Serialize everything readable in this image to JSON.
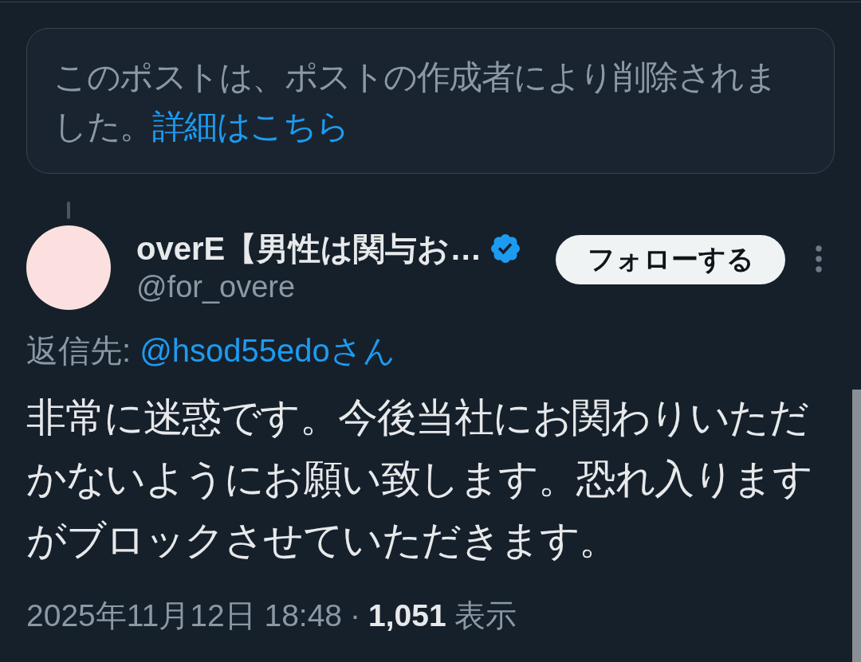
{
  "deleted_notice": {
    "text": "このポストは、ポストの作成者により削除されました。",
    "link": "詳細はこちら"
  },
  "post": {
    "author": {
      "display_name": "overE【男性は関与お…",
      "verified": true,
      "handle": "@for_overe"
    },
    "follow_button": "フォローする",
    "reply_to": {
      "label": "返信先:",
      "user": "@hsod55edoさん"
    },
    "text": "非常に迷惑です。今後当社にお関わりいただかないようにお願い致します。恐れ入りますがブロックさせていただきます。",
    "timestamp": "2025年11月12日 18:48",
    "separator": "·",
    "views": {
      "count": "1,051",
      "label": "表示"
    }
  }
}
